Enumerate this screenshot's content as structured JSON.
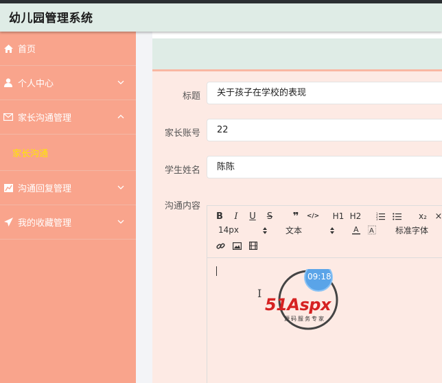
{
  "app": {
    "title": "幼儿园管理系统"
  },
  "sidebar": {
    "items": [
      {
        "label": "首页",
        "icon": "home-icon"
      },
      {
        "label": "个人中心",
        "icon": "user-icon"
      },
      {
        "label": "家长沟通管理",
        "icon": "mail-icon"
      },
      {
        "label": "沟通回复管理",
        "icon": "chart-icon"
      },
      {
        "label": "我的收藏管理",
        "icon": "send-icon"
      }
    ],
    "subitems": {
      "parent_communication": "家长沟通"
    },
    "active_color": "#ffe600",
    "background": "#f9a48c"
  },
  "form": {
    "title_label": "标题",
    "title_value": "关于孩子在学校的表现",
    "account_label": "家长账号",
    "account_value": "22",
    "student_label": "学生姓名",
    "student_value": "陈陈",
    "content_label": "沟通内容"
  },
  "editor": {
    "toolbar": {
      "bold": "B",
      "italic": "I",
      "underline": "U",
      "strike": "S",
      "quote": "❞",
      "code": "</>",
      "h1": "H1",
      "h2": "H2",
      "subscript": "x₂",
      "more": "×",
      "font_size": "14px",
      "paragraph": "文本",
      "font_family": "标准字体"
    }
  },
  "watermark": {
    "brand": "51Aspx",
    "slogan": "源码服务专家",
    "time": "09:18"
  }
}
